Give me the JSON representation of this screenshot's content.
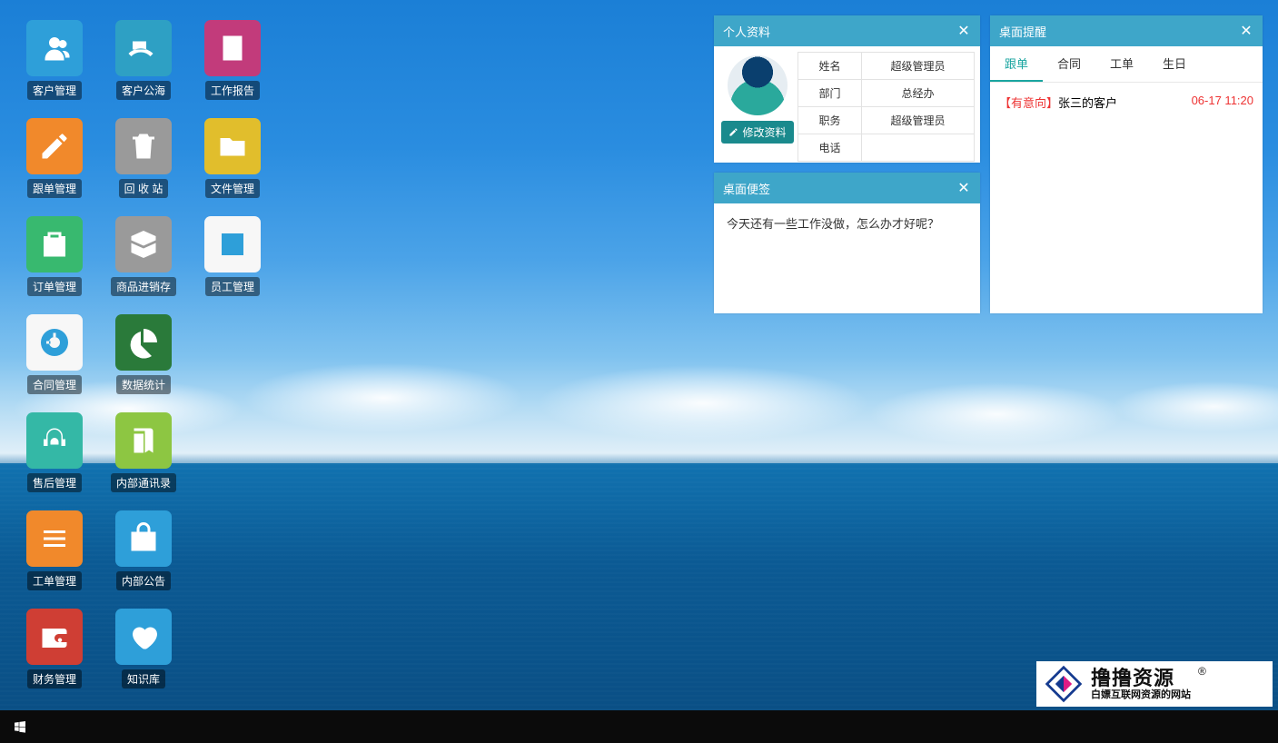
{
  "icon_style": {
    "radius": "7px"
  },
  "desktop_icons": [
    {
      "id": "customer-mgmt",
      "label": "客户管理",
      "icon": "users",
      "color": "#2e9fd9"
    },
    {
      "id": "customer-pool",
      "label": "客户公海",
      "icon": "serve",
      "color": "#2ea0c4"
    },
    {
      "id": "work-report",
      "label": "工作报告",
      "icon": "note",
      "color": "#c23b7b"
    },
    {
      "id": "followup-mgmt",
      "label": "跟单管理",
      "icon": "edit",
      "color": "#f1892b"
    },
    {
      "id": "recycle-bin",
      "label": "回 收 站",
      "icon": "trash",
      "color": "#9a9a9a"
    },
    {
      "id": "file-mgmt",
      "label": "文件管理",
      "icon": "folder",
      "color": "#e1be2c"
    },
    {
      "id": "order-mgmt",
      "label": "订单管理",
      "icon": "clipboard",
      "color": "#38b96f"
    },
    {
      "id": "inventory",
      "label": "商品进销存",
      "icon": "box",
      "color": "#9a9a9a"
    },
    {
      "id": "staff-mgmt",
      "label": "员工管理",
      "icon": "idcard",
      "color": "#f7f7f7",
      "fg": "#2e9fd9"
    },
    {
      "id": "contract-mgmt",
      "label": "合同管理",
      "icon": "disk",
      "color": "#f7f7f7",
      "fg": "#2e9fd9"
    },
    {
      "id": "stats",
      "label": "数据统计",
      "icon": "pie",
      "color": "#2a7a3a"
    },
    null,
    {
      "id": "aftersales",
      "label": "售后管理",
      "icon": "agent",
      "color": "#34b8a6"
    },
    {
      "id": "contacts",
      "label": "内部通讯录",
      "icon": "book",
      "color": "#8dc642"
    },
    null,
    {
      "id": "ticket-mgmt",
      "label": "工单管理",
      "icon": "list",
      "color": "#f1892b"
    },
    {
      "id": "announcement",
      "label": "内部公告",
      "icon": "bag",
      "color": "#2e9fd9"
    },
    null,
    {
      "id": "finance",
      "label": "财务管理",
      "icon": "wallet",
      "color": "#cf3e34"
    },
    {
      "id": "knowledge",
      "label": "知识库",
      "icon": "heart",
      "color": "#2e9fd9"
    },
    null
  ],
  "profile": {
    "title": "个人资料",
    "edit_label": "修改资料",
    "rows": [
      {
        "k": "姓名",
        "v": "超级管理员"
      },
      {
        "k": "部门",
        "v": "总经办"
      },
      {
        "k": "职务",
        "v": "超级管理员"
      },
      {
        "k": "电话",
        "v": ""
      }
    ]
  },
  "notes": {
    "title": "桌面便签",
    "text": "今天还有一些工作没做，怎么办才好呢？"
  },
  "reminders": {
    "title": "桌面提醒",
    "tabs": [
      "跟单",
      "合同",
      "工单",
      "生日"
    ],
    "activeTab": 0,
    "items": [
      {
        "tag": "【有意向】",
        "text": "张三的客户",
        "time": "06-17 11:20"
      }
    ]
  },
  "watermark": {
    "title": "撸撸资源",
    "sub": "白嫖互联网资源的网站",
    "reg": "®"
  },
  "close_glyph": "✕"
}
